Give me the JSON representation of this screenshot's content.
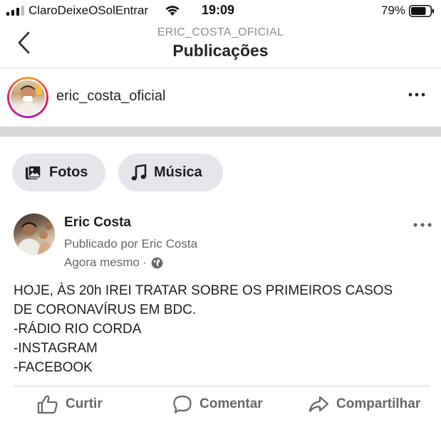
{
  "status_bar": {
    "carrier": "ClaroDeixeOSolEntrar",
    "time": "19:09",
    "battery": "79%",
    "battery_level": 0.79
  },
  "nav": {
    "subtitle": "ERIC_COSTA_OFICIAL",
    "title": "Publicações"
  },
  "post": {
    "username": "eric_costa_oficial"
  },
  "fb": {
    "buttons": {
      "photos": "Fotos",
      "music": "Música"
    },
    "author": "Eric Costa",
    "published_by": "Publicado por Eric Costa",
    "time": "Agora mesmo ·",
    "text_lines": [
      "HOJE, ÀS 20h IREI TRATAR SOBRE OS PRIMEIROS CASOS",
      "DE CORONAVÍRUS EM BDC.",
      "-RÁDIO RIO CORDA",
      "-INSTAGRAM",
      "-FACEBOOK"
    ],
    "actions": {
      "like": "Curtir",
      "comment": "Comentar",
      "share": "Compartilhar"
    }
  },
  "colors": {
    "fb_gray_text": "#65676b",
    "pill_bg": "#e4e6eb",
    "divider": "#d8d8d8"
  }
}
